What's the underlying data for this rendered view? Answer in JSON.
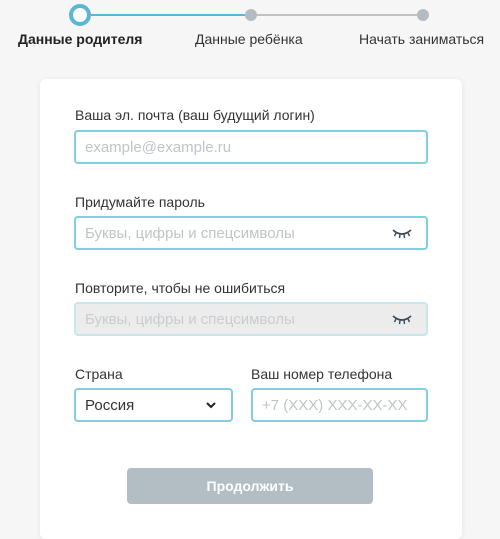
{
  "stepper": {
    "steps": [
      {
        "label": "Данные родителя",
        "state": "active"
      },
      {
        "label": "Данные ребёнка",
        "state": "pending"
      },
      {
        "label": "Начать заниматься",
        "state": "pending"
      }
    ]
  },
  "form": {
    "email": {
      "label": "Ваша эл. почта (ваш будущий логин)",
      "placeholder": "example@example.ru",
      "value": ""
    },
    "password": {
      "label": "Придумайте пароль",
      "placeholder": "Буквы, цифры и спецсимволы",
      "value": "",
      "icon": "eye-closed-icon"
    },
    "password_repeat": {
      "label": "Повторите, чтобы не ошибиться",
      "placeholder": "Буквы, цифры и спецсимволы",
      "value": "",
      "icon": "eye-closed-icon",
      "disabled": true
    },
    "country": {
      "label": "Страна",
      "selected": "Россия",
      "icon": "chevron-down-icon"
    },
    "phone": {
      "label": "Ваш номер телефона",
      "placeholder": "+7 (XXX) XXX-XX-XX",
      "value": ""
    },
    "submit_label": "Продолжить"
  },
  "colors": {
    "accent": "#58b7d6",
    "input_border": "#7fcfdc",
    "inactive": "#b4bcc2",
    "button_disabled": "#b3bec4",
    "background": "#f6f6f6"
  }
}
